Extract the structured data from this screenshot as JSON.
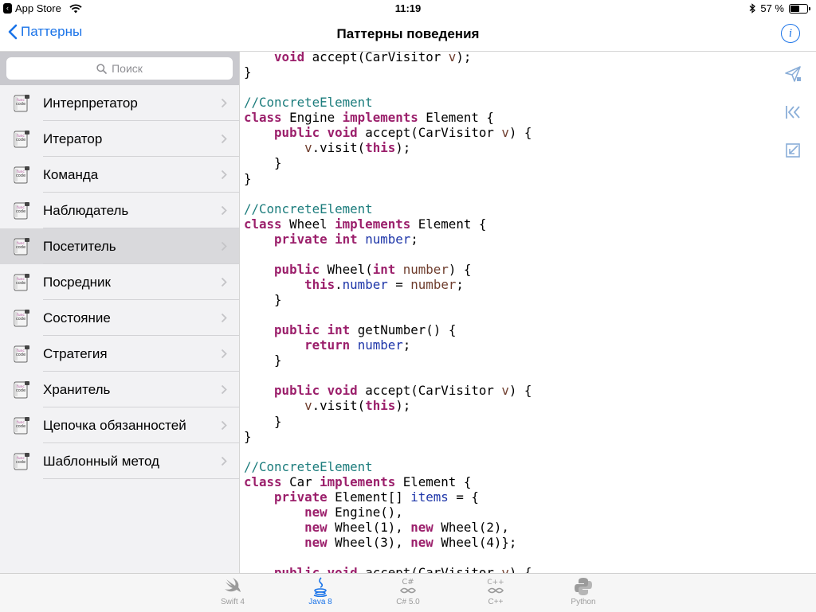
{
  "status_bar": {
    "back_app": "App Store",
    "time": "11:19",
    "battery": "57 %",
    "battery_level": 0.57
  },
  "nav": {
    "back_label": "Паттерны",
    "title": "Паттерны поведения"
  },
  "sidebar": {
    "search_placeholder": "Поиск",
    "icon_text": "code",
    "items": [
      {
        "label": "Интерпретатор"
      },
      {
        "label": "Итератор"
      },
      {
        "label": "Команда"
      },
      {
        "label": "Наблюдатель"
      },
      {
        "label": "Посетитель",
        "selected": true
      },
      {
        "label": "Посредник"
      },
      {
        "label": "Состояние"
      },
      {
        "label": "Стратегия"
      },
      {
        "label": "Хранитель"
      },
      {
        "label": "Цепочка обязанностей"
      },
      {
        "label": "Шаблонный метод"
      }
    ]
  },
  "code_lines": [
    [
      [
        "    ",
        ""
      ],
      [
        "void",
        "k"
      ],
      [
        " accept(CarVisitor ",
        ""
      ],
      [
        "v",
        "p"
      ],
      [
        ");",
        ""
      ]
    ],
    [
      [
        "}",
        ""
      ]
    ],
    [],
    [
      [
        "//ConcreteElement",
        "c"
      ]
    ],
    [
      [
        "class",
        "k"
      ],
      [
        " Engine ",
        ""
      ],
      [
        "implements",
        "k"
      ],
      [
        " Element {",
        ""
      ]
    ],
    [
      [
        "    ",
        ""
      ],
      [
        "public",
        "k"
      ],
      [
        " ",
        ""
      ],
      [
        "void",
        "k"
      ],
      [
        " accept(CarVisitor ",
        ""
      ],
      [
        "v",
        "p"
      ],
      [
        ") {",
        ""
      ]
    ],
    [
      [
        "        ",
        ""
      ],
      [
        "v",
        "p"
      ],
      [
        ".visit(",
        ""
      ],
      [
        "this",
        "k"
      ],
      [
        ");",
        ""
      ]
    ],
    [
      [
        "    }",
        ""
      ]
    ],
    [
      [
        "}",
        ""
      ]
    ],
    [],
    [
      [
        "//ConcreteElement",
        "c"
      ]
    ],
    [
      [
        "class",
        "k"
      ],
      [
        " Wheel ",
        ""
      ],
      [
        "implements",
        "k"
      ],
      [
        " Element {",
        ""
      ]
    ],
    [
      [
        "    ",
        ""
      ],
      [
        "private",
        "k"
      ],
      [
        " ",
        ""
      ],
      [
        "int",
        "k"
      ],
      [
        " ",
        ""
      ],
      [
        "number",
        "f"
      ],
      [
        ";",
        ""
      ]
    ],
    [],
    [
      [
        "    ",
        ""
      ],
      [
        "public",
        "k"
      ],
      [
        " Wheel(",
        ""
      ],
      [
        "int",
        "k"
      ],
      [
        " ",
        ""
      ],
      [
        "number",
        "p"
      ],
      [
        ") {",
        ""
      ]
    ],
    [
      [
        "        ",
        ""
      ],
      [
        "this",
        "k"
      ],
      [
        ".",
        ""
      ],
      [
        "number",
        "f"
      ],
      [
        " = ",
        ""
      ],
      [
        "number",
        "p"
      ],
      [
        ";",
        ""
      ]
    ],
    [
      [
        "    }",
        ""
      ]
    ],
    [],
    [
      [
        "    ",
        ""
      ],
      [
        "public",
        "k"
      ],
      [
        " ",
        ""
      ],
      [
        "int",
        "k"
      ],
      [
        " getNumber() {",
        ""
      ]
    ],
    [
      [
        "        ",
        ""
      ],
      [
        "return",
        "k"
      ],
      [
        " ",
        ""
      ],
      [
        "number",
        "f"
      ],
      [
        ";",
        ""
      ]
    ],
    [
      [
        "    }",
        ""
      ]
    ],
    [],
    [
      [
        "    ",
        ""
      ],
      [
        "public",
        "k"
      ],
      [
        " ",
        ""
      ],
      [
        "void",
        "k"
      ],
      [
        " accept(CarVisitor ",
        ""
      ],
      [
        "v",
        "p"
      ],
      [
        ") {",
        ""
      ]
    ],
    [
      [
        "        ",
        ""
      ],
      [
        "v",
        "p"
      ],
      [
        ".visit(",
        ""
      ],
      [
        "this",
        "k"
      ],
      [
        ");",
        ""
      ]
    ],
    [
      [
        "    }",
        ""
      ]
    ],
    [
      [
        "}",
        ""
      ]
    ],
    [],
    [
      [
        "//ConcreteElement",
        "c"
      ]
    ],
    [
      [
        "class",
        "k"
      ],
      [
        " Car ",
        ""
      ],
      [
        "implements",
        "k"
      ],
      [
        " Element {",
        ""
      ]
    ],
    [
      [
        "    ",
        ""
      ],
      [
        "private",
        "k"
      ],
      [
        " Element[] ",
        ""
      ],
      [
        "items",
        "f"
      ],
      [
        " = {",
        ""
      ]
    ],
    [
      [
        "        ",
        ""
      ],
      [
        "new",
        "k"
      ],
      [
        " Engine(),",
        ""
      ]
    ],
    [
      [
        "        ",
        ""
      ],
      [
        "new",
        "k"
      ],
      [
        " Wheel(1), ",
        ""
      ],
      [
        "new",
        "k"
      ],
      [
        " Wheel(2),",
        ""
      ]
    ],
    [
      [
        "        ",
        ""
      ],
      [
        "new",
        "k"
      ],
      [
        " Wheel(3), ",
        ""
      ],
      [
        "new",
        "k"
      ],
      [
        " Wheel(4)};",
        ""
      ]
    ],
    [],
    [
      [
        "    ",
        ""
      ],
      [
        "public",
        "k"
      ],
      [
        " ",
        ""
      ],
      [
        "void",
        "k"
      ],
      [
        " accept(CarVisitor ",
        ""
      ],
      [
        "v",
        "p"
      ],
      [
        ") {",
        ""
      ]
    ]
  ],
  "tabs": [
    {
      "label": "Swift 4",
      "icon": "swift-icon"
    },
    {
      "label": "Java 8",
      "icon": "java-icon",
      "active": true
    },
    {
      "label": "C# 5.0",
      "icon": "csharp-icon"
    },
    {
      "label": "C++",
      "icon": "cpp-icon"
    },
    {
      "label": "Python",
      "icon": "python-icon"
    }
  ],
  "colors": {
    "accent": "#1a73e8",
    "keyword": "#9b1f6b",
    "comment": "#1b7c7c",
    "param": "#6e3c2c",
    "field": "#1c34a8"
  }
}
